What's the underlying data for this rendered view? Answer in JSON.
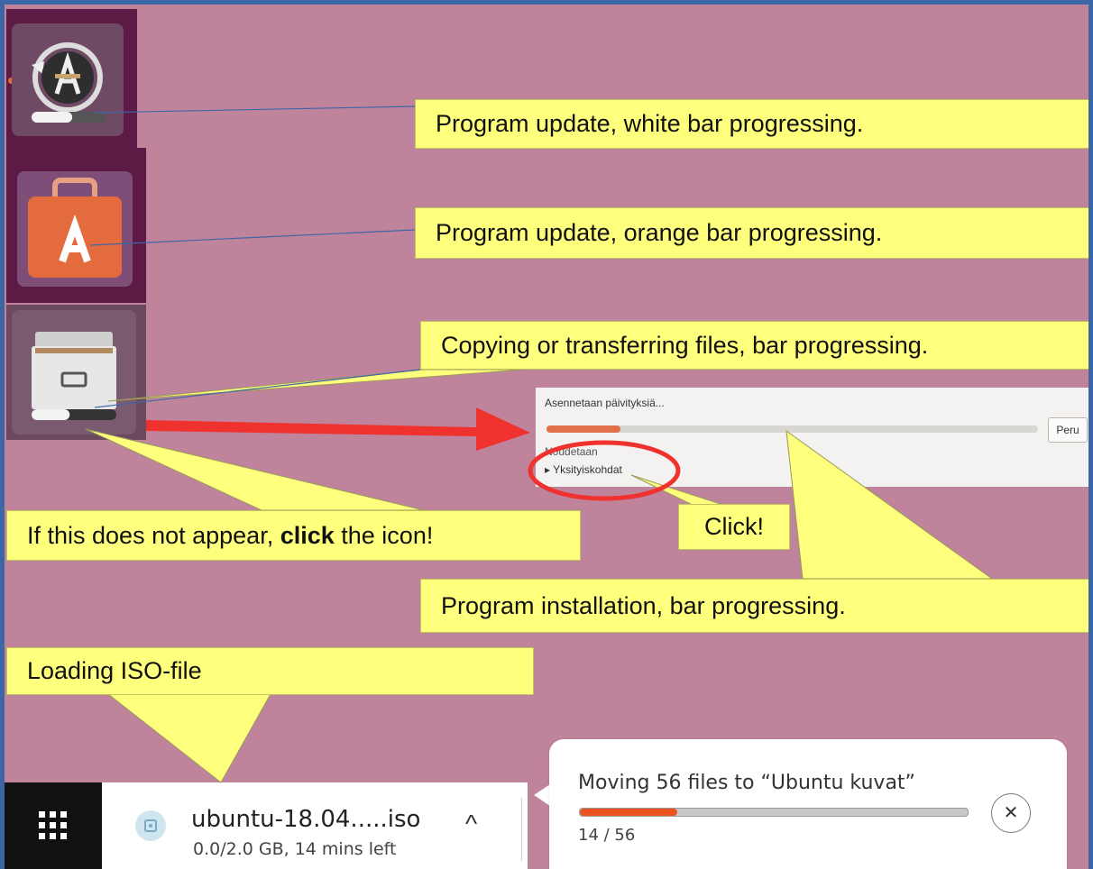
{
  "callouts": {
    "update_white": "Program update, white bar progressing.",
    "update_orange": "Program update, orange bar progressing.",
    "copying": "Copying or transferring files, bar progressing.",
    "click_icon_pre": "If this does not appear, ",
    "click_icon_bold": "click",
    "click_icon_post": " the icon!",
    "click": "Click!",
    "installation": "Program installation, bar progressing.",
    "loading_iso": "Loading ISO-file"
  },
  "install_dialog": {
    "title": "Asennetaan päivityksiä...",
    "progress": 0.15,
    "cancel_label": "Peru",
    "status": "Noudetaan",
    "details_label": "Yksityiskohdat"
  },
  "launcher": {
    "icons": [
      "software-updater-icon",
      "ubuntu-software-icon",
      "files-icon"
    ],
    "update_progress": 0.55,
    "files_progress": 0.45
  },
  "download": {
    "filename": "ubuntu-18.04.....iso",
    "info": "0.0/2.0 GB, 14 mins left"
  },
  "file_operation": {
    "title": "Moving 56 files to “Ubuntu kuvat”",
    "count": "14 / 56",
    "progress": 0.25
  },
  "colors": {
    "desktop": "#c0839c",
    "callout": "#ffff7e",
    "accent_orange": "#e95420",
    "arrow_red": "#f0322e"
  }
}
